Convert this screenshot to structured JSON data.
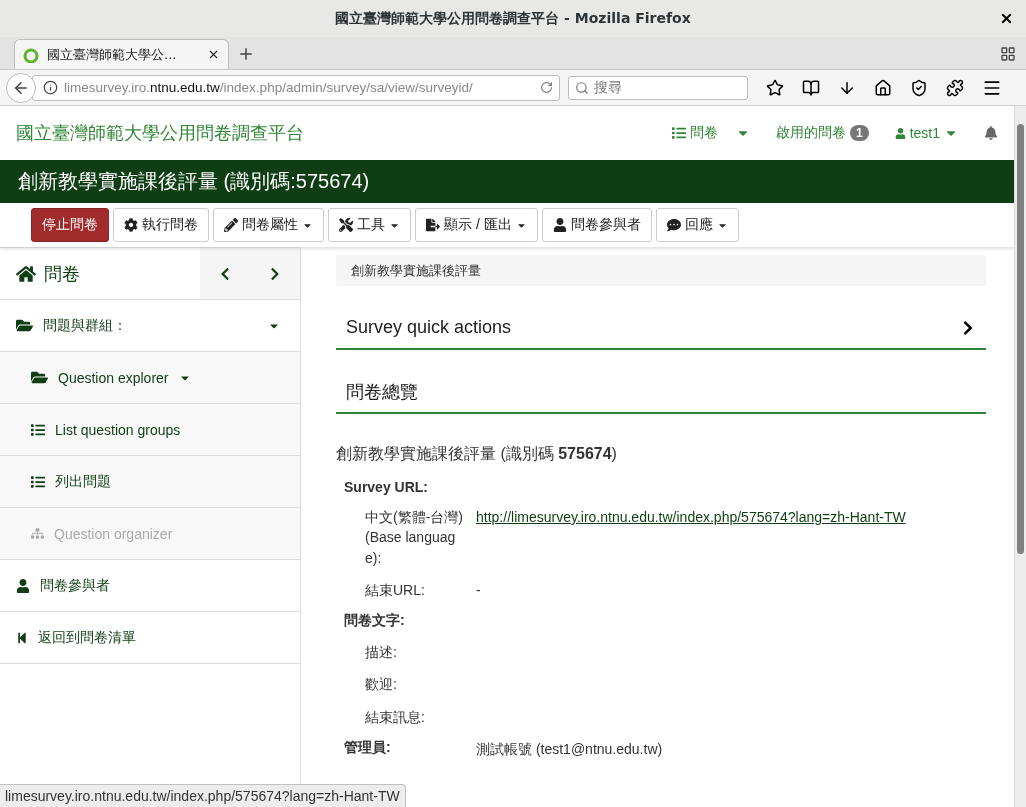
{
  "browser": {
    "window_title": "國立臺灣師範大學公用問卷調查平台 - Mozilla Firefox",
    "tab_title": "國立臺灣師範大學公...",
    "url_host_pre": "limesurvey.iro.",
    "url_host_main": "ntnu.edu.tw",
    "url_path": "/index.php/admin/survey/sa/view/surveyid/",
    "search_placeholder": "搜尋"
  },
  "navbar": {
    "brand": "國立臺灣師範大學公用問卷調查平台",
    "surveys_menu": "問卷",
    "active_surveys": "啟用的問卷",
    "active_count": "1",
    "user": "test1"
  },
  "survey_title": "創新教學實施課後評量 (識別碼:575674)",
  "toolbar": [
    {
      "label": "停止問卷",
      "kind": "danger",
      "caret": false
    },
    {
      "label": "執行問卷",
      "kind": "default",
      "caret": false
    },
    {
      "label": "問卷屬性",
      "kind": "default",
      "caret": true
    },
    {
      "label": "工具",
      "kind": "default",
      "caret": true
    },
    {
      "label": "顯示 / 匯出",
      "kind": "default",
      "caret": true
    },
    {
      "label": "問卷參與者",
      "kind": "default",
      "caret": false
    },
    {
      "label": "回應",
      "kind": "default",
      "caret": true
    }
  ],
  "sidebar": {
    "title": "問卷",
    "items": [
      {
        "label": "問題與群組：",
        "kind": "section",
        "caret": true,
        "disabled": false
      },
      {
        "label": "Question explorer",
        "kind": "sub",
        "caret": true,
        "disabled": false
      },
      {
        "label": "List question groups",
        "kind": "sub",
        "caret": false,
        "disabled": false
      },
      {
        "label": "列出問題",
        "kind": "sub",
        "caret": false,
        "disabled": false
      },
      {
        "label": "Question organizer",
        "kind": "sub",
        "caret": false,
        "disabled": true
      },
      {
        "label": "問卷參與者",
        "kind": "section",
        "caret": false,
        "disabled": false
      },
      {
        "label": "返回到問卷清單",
        "kind": "section",
        "caret": false,
        "disabled": false
      }
    ]
  },
  "breadcrumb": "創新教學實施課後評量",
  "quick_actions": "Survey quick actions",
  "overview_heading": "問卷總覽",
  "summary_title": "創新教學實施課後評量 (識別碼 **575674**)",
  "details": [
    {
      "kind": "heading",
      "label": "Survey URL:"
    },
    {
      "kind": "link",
      "label": "中文(繁體-台灣) (Base language):",
      "value": "http://limesurvey.iro.ntnu.edu.tw/index.php/575674?lang=zh-Hant-TW"
    },
    {
      "kind": "field",
      "label": "結束URL:",
      "value": "-"
    },
    {
      "kind": "heading",
      "label": "問卷文字:"
    },
    {
      "kind": "field",
      "label": "描述:"
    },
    {
      "kind": "field",
      "label": "歡迎:"
    },
    {
      "kind": "field",
      "label": "結束訊息:"
    },
    {
      "kind": "heading",
      "label": "管理員:",
      "value": "測試帳號 (test1@ntnu.edu.tw)"
    }
  ],
  "status_bar": "limesurvey.iro.ntnu.edu.tw/index.php/575674?lang=zh-Hant-TW"
}
